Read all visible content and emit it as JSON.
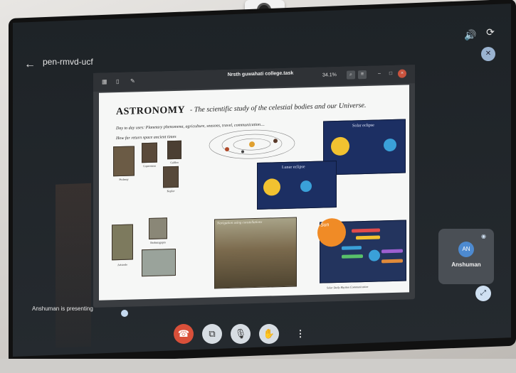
{
  "window": {
    "meeting_code": "pen-rmvd-ucf",
    "back_icon": "arrow-left-icon",
    "top_icons": [
      "volume-icon",
      "switch-camera-icon",
      "camera-off-icon"
    ]
  },
  "presented_window": {
    "title": "Nrsth guwahati college.task",
    "subtitle": "",
    "zoom": "34.1%",
    "controls": [
      "search-icon",
      "menu-icon",
      "minimize-icon",
      "maximize-icon",
      "close-icon"
    ]
  },
  "slide": {
    "title": "ASTRONOMY",
    "subtitle": "- The scientific study of the celestial bodies and our Universe.",
    "lines": [
      "Day to day uses: Planetary phenomena, agriculture, seasons, travel, communication....",
      "How far return space ancient times"
    ],
    "portrait_captions": [
      "Ptolemy",
      "Copernicus",
      "Galileo",
      "Kepler",
      "Aristotle",
      "Brahmagupta"
    ],
    "solar_eclipse_label": "Solar eclipse",
    "lunar_eclipse_label": "Lunar eclipse",
    "painting_caption": "Navigation using constellations",
    "mindmap_sun_label": "Sun",
    "mindmap_caption": "Solar Daily Rhythm Communication"
  },
  "presenter": {
    "name": "Anshuman",
    "initials": "AN",
    "status": "Anshuman is presenting"
  },
  "controls": {
    "hangup": "end-call-icon",
    "captions": "captions-icon",
    "mic": "mic-off-icon",
    "hand": "raise-hand-icon",
    "more": "⋮"
  },
  "colors": {
    "hangup": "#d9503a",
    "accent": "#c5d9ef",
    "slide_bg": "#f6f7f6",
    "eclipse_panel": "#1c2f63"
  }
}
